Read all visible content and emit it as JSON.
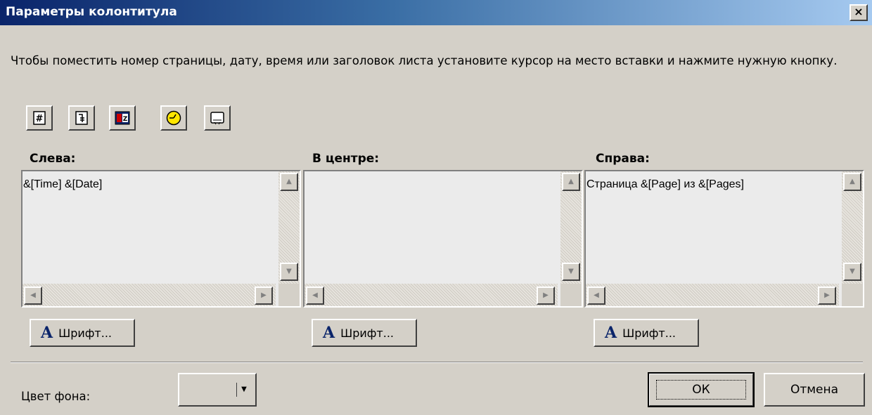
{
  "window": {
    "title": "Параметры колонтитула",
    "close_label": "×"
  },
  "instruction": "Чтобы поместить номер страницы, дату, время или заголовок листа установите курсор на место вставки и нажмите нужную кнопку.",
  "toolbar": {
    "buttons": [
      {
        "icon": "page-number-icon"
      },
      {
        "icon": "page-count-icon"
      },
      {
        "icon": "date-icon"
      },
      {
        "icon": "time-icon"
      },
      {
        "icon": "sheet-title-icon"
      }
    ]
  },
  "sections": {
    "left": {
      "label": "Слева:",
      "text": "&[Time] &[Date]",
      "font_button": "Шрифт..."
    },
    "center": {
      "label": "В центре:",
      "text": "",
      "font_button": "Шрифт..."
    },
    "right": {
      "label": "Справа:",
      "text": "Страница &[Page] из &[Pages]",
      "font_button": "Шрифт..."
    }
  },
  "background": {
    "label": "Цвет фона:",
    "value": ""
  },
  "buttons": {
    "ok": "ОК",
    "cancel": "Отмена"
  },
  "colors": {
    "title_gradient_start": "#0a246a",
    "title_gradient_end": "#a6caf0",
    "face": "#d4d0c8",
    "editor_bg": "#ebebeb"
  }
}
